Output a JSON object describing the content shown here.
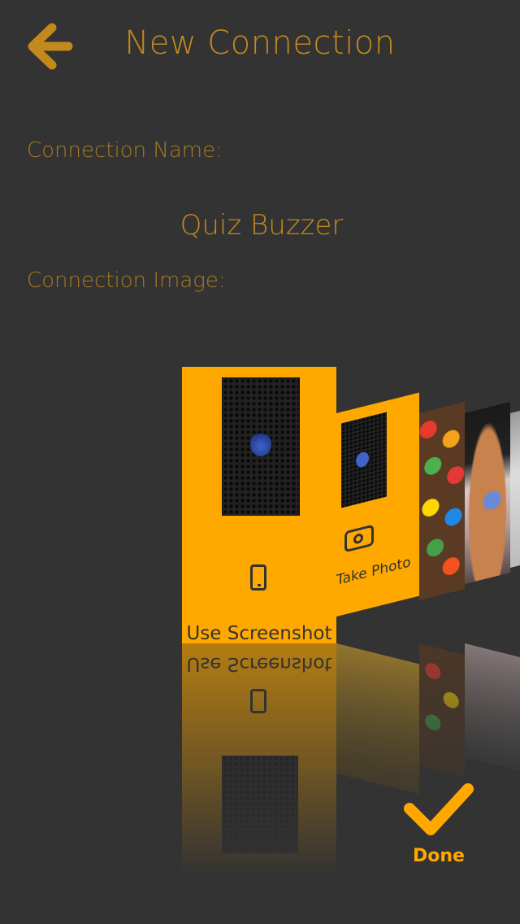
{
  "header": {
    "title": "New Connection",
    "back_icon": "arrow-left-icon"
  },
  "form": {
    "name_label": "Connection Name:",
    "name_value": "Quiz Buzzer",
    "image_label": "Connection Image:"
  },
  "image_picker": {
    "options": [
      {
        "label": "Use Screenshot",
        "icon": "phone-icon"
      },
      {
        "label": "Take Photo",
        "icon": "camera-icon"
      }
    ]
  },
  "footer": {
    "done_label": "Done",
    "done_icon": "checkmark-icon"
  },
  "colors": {
    "background": "#333333",
    "accent": "#FFA800",
    "label": "#A67A22"
  }
}
